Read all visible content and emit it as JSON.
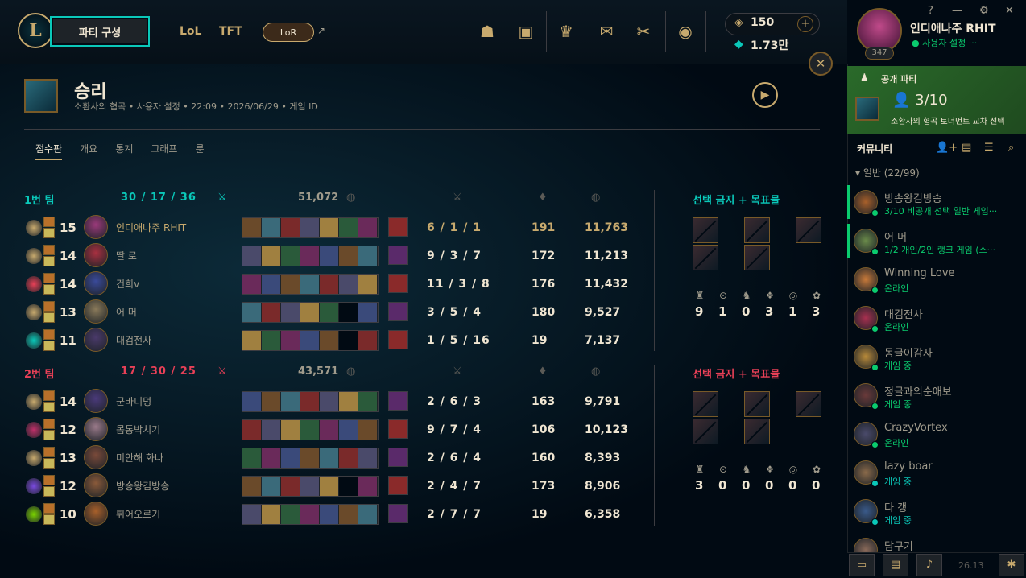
{
  "header": {
    "party_button": "파티 구성",
    "nav": [
      "LoL",
      "TFT"
    ],
    "lor_button": "LoR",
    "lor_arrow": "↗",
    "currency": {
      "be": "150",
      "rp": "1.73만",
      "plus": "+"
    },
    "profile": {
      "name": "인디애나주 RHIT",
      "status": "사용자 설정 ···",
      "level": "347"
    },
    "window": {
      "help": "?",
      "min": "—",
      "settings": "⚙",
      "close": "✕"
    },
    "close_panel": "✕"
  },
  "game": {
    "result": "승리",
    "meta": "소환사의 협곡  •  사용자 설정  •  22:09  •  2026/06/29  •  게임 ID",
    "tabs": [
      "점수판",
      "개요",
      "통계",
      "그래프",
      "룬"
    ]
  },
  "teams": [
    {
      "name": "1번 팀",
      "kda": "30  /  17  /  36",
      "gold": "51,072",
      "color": "#0ac8b9",
      "bans_title": "선택 금지 + 목표물",
      "objectives": [
        "9",
        "1",
        "0",
        "3",
        "1",
        "3"
      ],
      "players": [
        {
          "level": "15",
          "name": "인디애나주 RHIT",
          "kda": "6 / 1 / 1",
          "cs": "191",
          "gold": "11,763",
          "highlight": true
        },
        {
          "level": "14",
          "name": "딸 로",
          "kda": "9 / 3 / 7",
          "cs": "172",
          "gold": "11,213"
        },
        {
          "level": "14",
          "name": "건희v",
          "kda": "11 / 3 / 8",
          "cs": "176",
          "gold": "11,432"
        },
        {
          "level": "13",
          "name": "어 머",
          "kda": "3 / 5 / 4",
          "cs": "180",
          "gold": "9,527"
        },
        {
          "level": "11",
          "name": "대검전사",
          "kda": "1 / 5 / 16",
          "cs": "19",
          "gold": "7,137"
        }
      ]
    },
    {
      "name": "2번 팀",
      "kda": "17  /  30  /  25",
      "gold": "43,571",
      "color": "#e84057",
      "bans_title": "선택 금지 + 목표물",
      "objectives": [
        "3",
        "0",
        "0",
        "0",
        "0",
        "0"
      ],
      "players": [
        {
          "level": "14",
          "name": "군바디덩",
          "kda": "2 / 6 / 3",
          "cs": "163",
          "gold": "9,791"
        },
        {
          "level": "12",
          "name": "몸통박치기",
          "kda": "9 / 7 / 4",
          "cs": "106",
          "gold": "10,123"
        },
        {
          "level": "13",
          "name": "미안해 화나",
          "kda": "2 / 6 / 4",
          "cs": "160",
          "gold": "8,393"
        },
        {
          "level": "12",
          "name": "방송왕김방송",
          "kda": "2 / 4 / 7",
          "cs": "173",
          "gold": "8,906"
        },
        {
          "level": "10",
          "name": "튀어오르기",
          "kda": "2 / 7 / 7",
          "cs": "19",
          "gold": "6,358"
        }
      ]
    }
  ],
  "social": {
    "party_title": "공개 파티",
    "party_count": "3/10",
    "party_mode": "소환사의 협곡 토너먼트 교차 선택",
    "community": "커뮤니티",
    "group": "▾  일반 (22/99)",
    "friends": [
      {
        "name": "방송왕김방송",
        "status": "3/10 비공개 선택 일반 게임···",
        "color": "#0acb6e",
        "bar": true
      },
      {
        "name": "어 머",
        "status": "1/2 개인/2인 랭크 게임 (소···",
        "color": "#0acb6e",
        "bar": true
      },
      {
        "name": "Winning Love",
        "status": "온라인",
        "color": "#0acb6e"
      },
      {
        "name": "대검전사",
        "status": "온라인",
        "color": "#0acb6e"
      },
      {
        "name": "동글이감자",
        "status": "게임 중",
        "color": "#0acb6e"
      },
      {
        "name": "정글과의순애보",
        "status": "게임 중",
        "color": "#0acb6e"
      },
      {
        "name": "CrazyVortex",
        "status": "온라인",
        "color": "#0acb6e"
      },
      {
        "name": "lazy boar",
        "status": "게임 중",
        "color": "#0ac8b9"
      },
      {
        "name": "다 갱",
        "status": "게임 중",
        "color": "#0ac8b9"
      },
      {
        "name": "담구기",
        "status": "",
        "color": "#0acb6e"
      }
    ],
    "version": "26.13"
  }
}
